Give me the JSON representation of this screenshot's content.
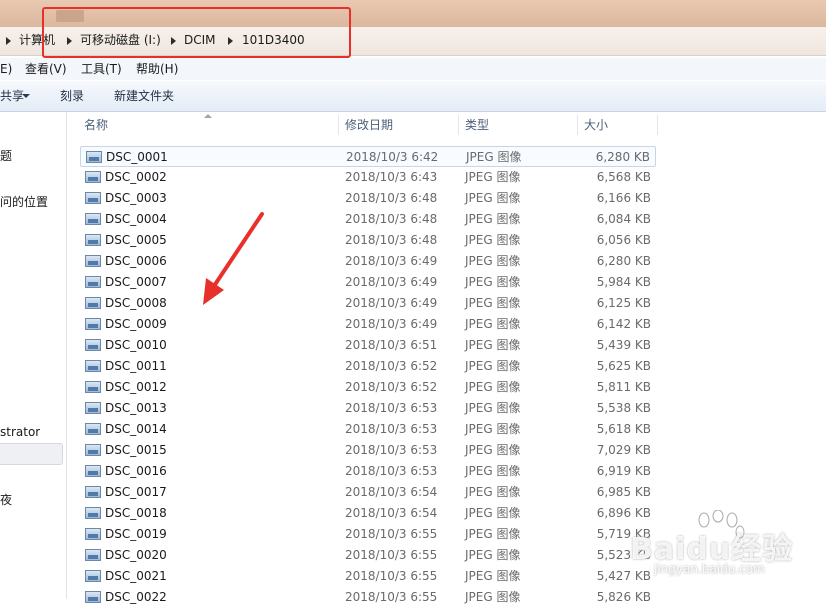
{
  "address": {
    "crumbs": [
      "计算机",
      "可移动磁盘 (I:)",
      "DCIM",
      "101D3400"
    ]
  },
  "menu": {
    "items": [
      "E)",
      "查看(V)",
      "工具(T)",
      "帮助(H)"
    ]
  },
  "toolbar": {
    "share_label": "共享",
    "burn_label": "刻录",
    "new_folder_label": "新建文件夹"
  },
  "nav": {
    "items": [
      "题",
      "问的位置",
      "strator",
      "夜"
    ]
  },
  "columns": {
    "name": "名称",
    "date": "修改日期",
    "type": "类型",
    "size": "大小"
  },
  "files": [
    {
      "name": "DSC_0001",
      "date": "2018/10/3 6:42",
      "type": "JPEG 图像",
      "size": "6,280 KB"
    },
    {
      "name": "DSC_0002",
      "date": "2018/10/3 6:43",
      "type": "JPEG 图像",
      "size": "6,568 KB"
    },
    {
      "name": "DSC_0003",
      "date": "2018/10/3 6:48",
      "type": "JPEG 图像",
      "size": "6,166 KB"
    },
    {
      "name": "DSC_0004",
      "date": "2018/10/3 6:48",
      "type": "JPEG 图像",
      "size": "6,084 KB"
    },
    {
      "name": "DSC_0005",
      "date": "2018/10/3 6:48",
      "type": "JPEG 图像",
      "size": "6,056 KB"
    },
    {
      "name": "DSC_0006",
      "date": "2018/10/3 6:49",
      "type": "JPEG 图像",
      "size": "6,280 KB"
    },
    {
      "name": "DSC_0007",
      "date": "2018/10/3 6:49",
      "type": "JPEG 图像",
      "size": "5,984 KB"
    },
    {
      "name": "DSC_0008",
      "date": "2018/10/3 6:49",
      "type": "JPEG 图像",
      "size": "6,125 KB"
    },
    {
      "name": "DSC_0009",
      "date": "2018/10/3 6:49",
      "type": "JPEG 图像",
      "size": "6,142 KB"
    },
    {
      "name": "DSC_0010",
      "date": "2018/10/3 6:51",
      "type": "JPEG 图像",
      "size": "5,439 KB"
    },
    {
      "name": "DSC_0011",
      "date": "2018/10/3 6:52",
      "type": "JPEG 图像",
      "size": "5,625 KB"
    },
    {
      "name": "DSC_0012",
      "date": "2018/10/3 6:52",
      "type": "JPEG 图像",
      "size": "5,811 KB"
    },
    {
      "name": "DSC_0013",
      "date": "2018/10/3 6:53",
      "type": "JPEG 图像",
      "size": "5,538 KB"
    },
    {
      "name": "DSC_0014",
      "date": "2018/10/3 6:53",
      "type": "JPEG 图像",
      "size": "5,618 KB"
    },
    {
      "name": "DSC_0015",
      "date": "2018/10/3 6:53",
      "type": "JPEG 图像",
      "size": "7,029 KB"
    },
    {
      "name": "DSC_0016",
      "date": "2018/10/3 6:53",
      "type": "JPEG 图像",
      "size": "6,919 KB"
    },
    {
      "name": "DSC_0017",
      "date": "2018/10/3 6:54",
      "type": "JPEG 图像",
      "size": "6,985 KB"
    },
    {
      "name": "DSC_0018",
      "date": "2018/10/3 6:54",
      "type": "JPEG 图像",
      "size": "6,896 KB"
    },
    {
      "name": "DSC_0019",
      "date": "2018/10/3 6:55",
      "type": "JPEG 图像",
      "size": "5,719 KB"
    },
    {
      "name": "DSC_0020",
      "date": "2018/10/3 6:55",
      "type": "JPEG 图像",
      "size": "5,523 KB"
    },
    {
      "name": "DSC_0021",
      "date": "2018/10/3 6:55",
      "type": "JPEG 图像",
      "size": "5,427 KB"
    },
    {
      "name": "DSC_0022",
      "date": "2018/10/3 6:55",
      "type": "JPEG 图像",
      "size": "5,826 KB"
    }
  ],
  "watermark": {
    "text": "Baidu经验",
    "sub": "jingyan.baidu.com"
  },
  "colors": {
    "highlight": "#e8302a",
    "arrow": "#e8302a"
  }
}
